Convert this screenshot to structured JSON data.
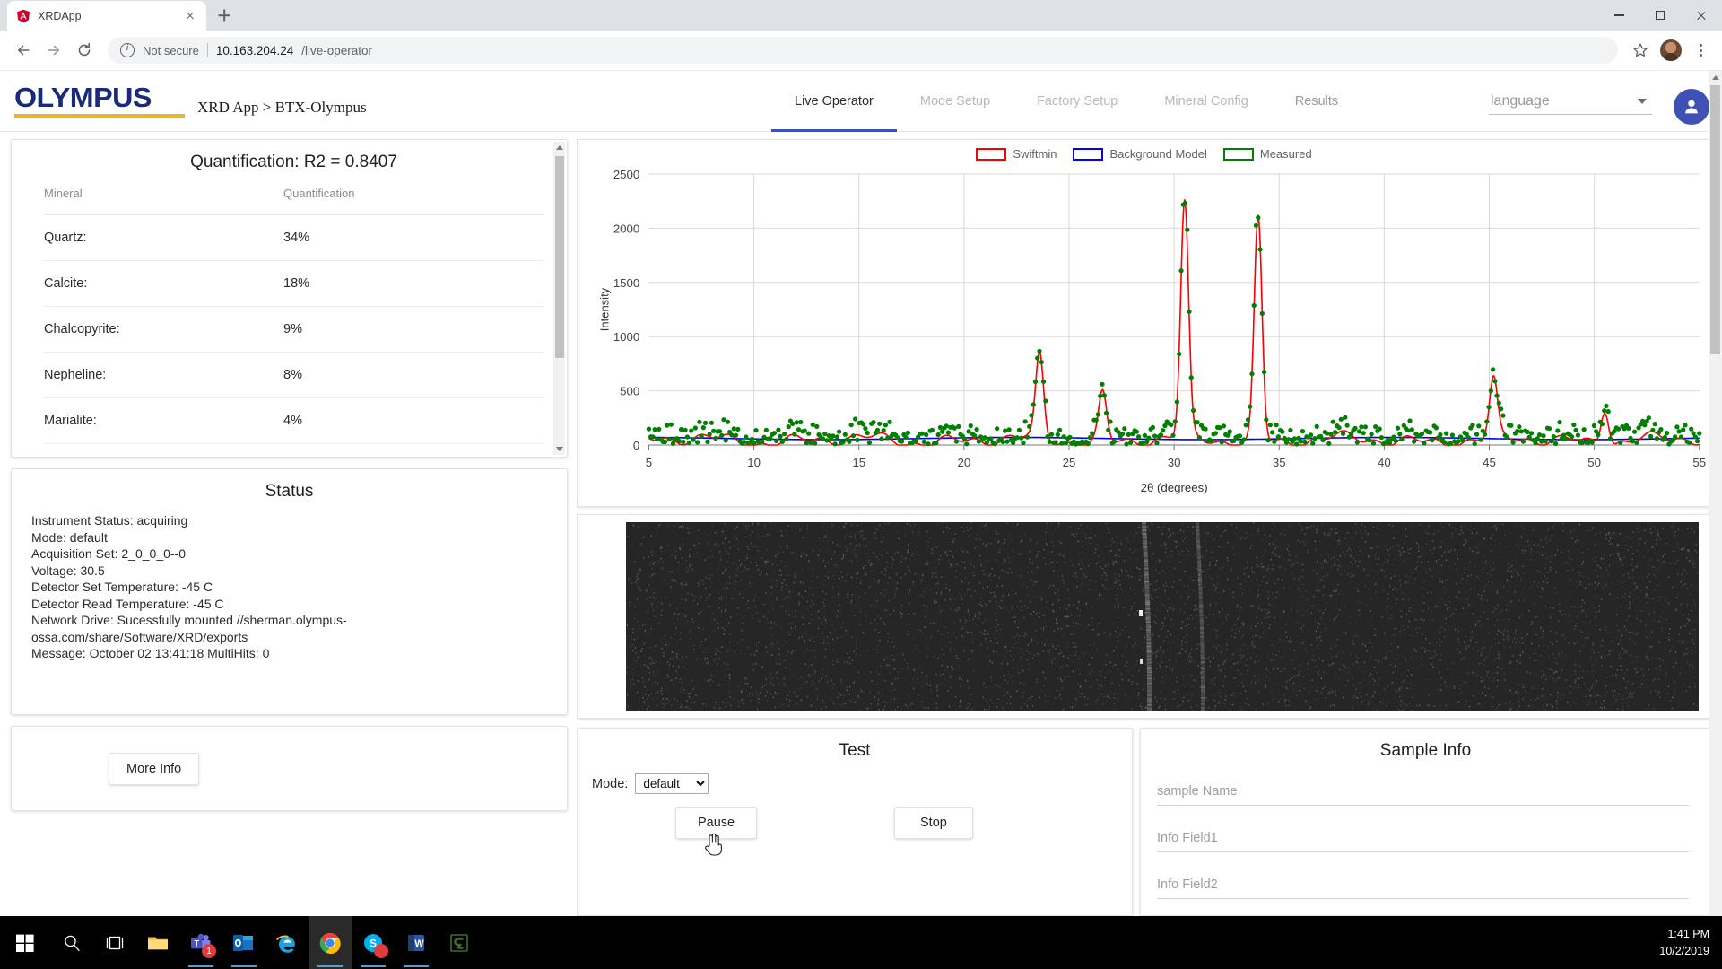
{
  "browser": {
    "tab_title": "XRDApp",
    "tab_favicon": "angular-icon",
    "new_tab_label": "+",
    "security_label": "Not secure",
    "url_host": "10.163.204.24",
    "url_path": "/live-operator",
    "back_icon": "back-arrow-icon",
    "forward_icon": "forward-arrow-icon",
    "reload_icon": "reload-icon",
    "bookmark_icon": "star-icon",
    "menu_icon": "kebab-menu-icon",
    "minimize_icon": "minimize-icon",
    "maximize_icon": "maximize-icon",
    "close_icon": "close-icon"
  },
  "header": {
    "logo": "OLYMPUS",
    "breadcrumb": "XRD App > BTX-Olympus",
    "tabs": [
      {
        "label": "Live Operator",
        "active": true
      },
      {
        "label": "Mode Setup",
        "active": false
      },
      {
        "label": "Factory Setup",
        "active": false
      },
      {
        "label": "Mineral Config",
        "active": false
      },
      {
        "label": "Results",
        "active": false
      }
    ],
    "language_placeholder": "language",
    "language_options": [
      "language"
    ],
    "avatar_icon": "person-icon",
    "accent_color": "#3f51b5",
    "logo_color": "#1a2a7a",
    "logo_underline_color": "#e8b62c"
  },
  "quantification": {
    "title": "Quantification: R2 = 0.8407",
    "columns": [
      "Mineral",
      "Quantification"
    ],
    "rows": [
      {
        "mineral": "Quartz:",
        "value": "34%"
      },
      {
        "mineral": "Calcite:",
        "value": "18%"
      },
      {
        "mineral": "Chalcopyrite:",
        "value": "9%"
      },
      {
        "mineral": "Nepheline:",
        "value": "8%"
      },
      {
        "mineral": "Marialite:",
        "value": "4%"
      }
    ]
  },
  "status": {
    "title": "Status",
    "lines": [
      "Instrument Status: acquiring",
      "Mode: default",
      "Acquisition Set: 2_0_0_0--0",
      "Voltage: 30.5",
      "Detector Set Temperature: -45 C",
      "Detector Read Temperature: -45 C",
      "Network Drive: Sucessfully mounted //sherman.olympus-",
      "ossa.com/share/Software/XRD/exports",
      "Message: October 02 13:41:18 MultiHits: 0"
    ]
  },
  "more_info": {
    "label": "More Info"
  },
  "test_panel": {
    "title": "Test",
    "mode_label": "Mode:",
    "mode_value": "default",
    "mode_options": [
      "default"
    ],
    "pause_label": "Pause",
    "stop_label": "Stop",
    "cursor": "hand-cursor-icon"
  },
  "sample_info": {
    "title": "Sample Info",
    "fields": [
      {
        "placeholder": "sample Name",
        "value": ""
      },
      {
        "placeholder": "Info Field1",
        "value": ""
      },
      {
        "placeholder": "Info Field2",
        "value": ""
      }
    ]
  },
  "detector_image": {
    "name": "detector-frame-image"
  },
  "taskbar": {
    "items": [
      {
        "name": "start-button",
        "icon": "windows-icon"
      },
      {
        "name": "search-button",
        "icon": "search-icon"
      },
      {
        "name": "task-view-button",
        "icon": "task-view-icon"
      },
      {
        "name": "file-explorer",
        "icon": "folder-icon"
      },
      {
        "name": "microsoft-teams",
        "icon": "teams-icon",
        "badge": "1"
      },
      {
        "name": "outlook",
        "icon": "outlook-icon"
      },
      {
        "name": "internet-explorer",
        "icon": "ie-icon"
      },
      {
        "name": "google-chrome",
        "icon": "chrome-icon",
        "active": true
      },
      {
        "name": "skype",
        "icon": "skype-icon",
        "badge": ""
      },
      {
        "name": "microsoft-word",
        "icon": "word-icon"
      },
      {
        "name": "green-c-app",
        "icon": "c-app-icon"
      }
    ],
    "time": "1:41 PM",
    "date": "10/2/2019"
  },
  "chart_data": {
    "type": "scatter",
    "title": "",
    "xlabel": "2θ (degrees)",
    "ylabel": "Intensity",
    "xlim": [
      5,
      55
    ],
    "ylim": [
      0,
      2500
    ],
    "xticks": [
      5,
      10,
      15,
      20,
      25,
      30,
      35,
      40,
      45,
      50,
      55
    ],
    "yticks": [
      0,
      500,
      1000,
      1500,
      2000,
      2500
    ],
    "grid": true,
    "legend_position": "top-center",
    "legend": [
      {
        "name": "Swiftmin",
        "color": "#ff0000",
        "style": "line"
      },
      {
        "name": "Background Model",
        "color": "#0000ff",
        "style": "line"
      },
      {
        "name": "Measured",
        "color": "#008000",
        "style": "scatter"
      }
    ],
    "peaks": [
      {
        "x": 23.6,
        "intensity": 750
      },
      {
        "x": 26.6,
        "intensity": 430
      },
      {
        "x": 30.5,
        "intensity": 2150
      },
      {
        "x": 34.0,
        "intensity": 2050
      },
      {
        "x": 45.2,
        "intensity": 520
      },
      {
        "x": 50.5,
        "intensity": 330
      }
    ],
    "background_level": 60,
    "noise_baseline": 180,
    "series": [
      {
        "name": "Measured",
        "color": "#008000",
        "type": "scatter",
        "note": "dense green points, baseline noise 50-350 with peak points to 2150"
      },
      {
        "name": "Swiftmin",
        "color": "#ff0000",
        "type": "line",
        "note": "red fitted curve through peaks"
      },
      {
        "name": "Background Model",
        "color": "#0000ff",
        "type": "line",
        "note": "flat blue line near 60"
      }
    ]
  }
}
